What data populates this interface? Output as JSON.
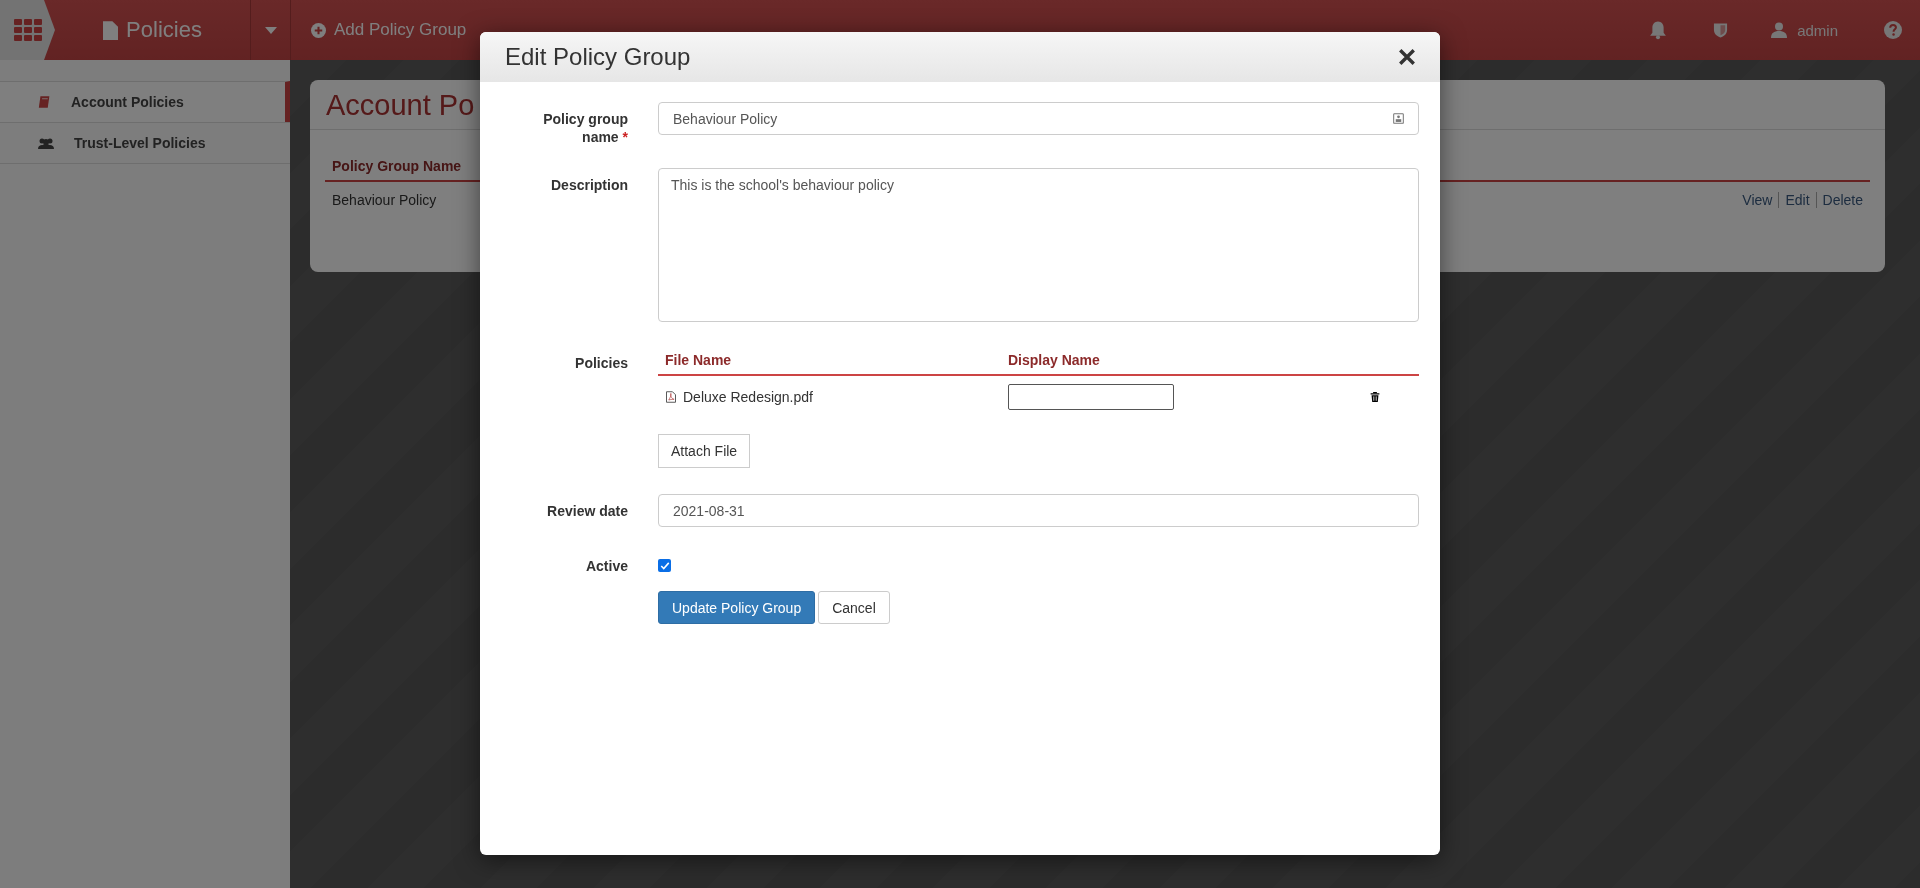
{
  "app_bar": {
    "module_title": "Policies",
    "actions": [
      {
        "label": "Add Policy Group"
      }
    ],
    "user": "admin"
  },
  "sidebar": {
    "items": [
      {
        "label": "Account Policies",
        "selected": true
      },
      {
        "label": "Trust-Level Policies",
        "selected": false
      }
    ]
  },
  "page": {
    "title": "Account Po",
    "table": {
      "columns": [
        "Policy Group Name"
      ],
      "rows": [
        {
          "name": "Behaviour Policy",
          "actions": [
            "View",
            "Edit",
            "Delete"
          ]
        }
      ]
    }
  },
  "dialog": {
    "title": "Edit Policy Group",
    "fields": [
      {
        "kind": "text",
        "label": "Policy group name",
        "required_mark": "*",
        "value": "Behaviour Policy"
      },
      {
        "kind": "textarea",
        "label": "Description",
        "value": "This is the school's behaviour policy"
      },
      {
        "kind": "files",
        "label": "Policies",
        "columns": [
          "File Name",
          "Display Name"
        ],
        "files": [
          {
            "name": "Deluxe Redesign.pdf"
          }
        ],
        "attach_button": "Attach File"
      },
      {
        "kind": "text",
        "label": "Review date",
        "value": "2021-08-31"
      },
      {
        "kind": "checkbox",
        "label": "Active",
        "checked": true
      }
    ],
    "buttons": [
      {
        "label": "Update Policy Group",
        "primary": true
      },
      {
        "label": "Cancel",
        "primary": false
      }
    ]
  }
}
